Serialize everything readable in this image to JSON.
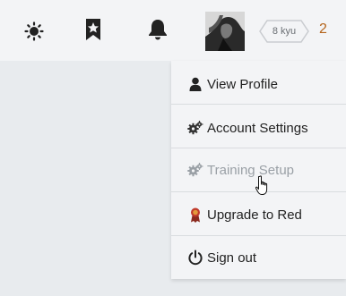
{
  "topbar": {
    "icons": [
      "sun-icon",
      "bookmark-star-icon",
      "bell-icon"
    ],
    "rank_label": "8 kyu",
    "honor_value": "2"
  },
  "menu": {
    "items": [
      {
        "label": "View Profile",
        "icon": "user-icon",
        "disabled": false
      },
      {
        "label": "Account Settings",
        "icon": "gears-icon",
        "disabled": false
      },
      {
        "label": "Training Setup",
        "icon": "gears-icon",
        "disabled": true
      },
      {
        "label": "Upgrade to Red",
        "icon": "ribbon-icon",
        "disabled": false
      },
      {
        "label": "Sign out",
        "icon": "power-icon",
        "disabled": false
      }
    ]
  },
  "colors": {
    "background": "#e8ebee",
    "bar": "#f3f4f6",
    "honor": "#b5651d",
    "ribbon": "#c0392b",
    "disabled": "#9aa0a6"
  }
}
